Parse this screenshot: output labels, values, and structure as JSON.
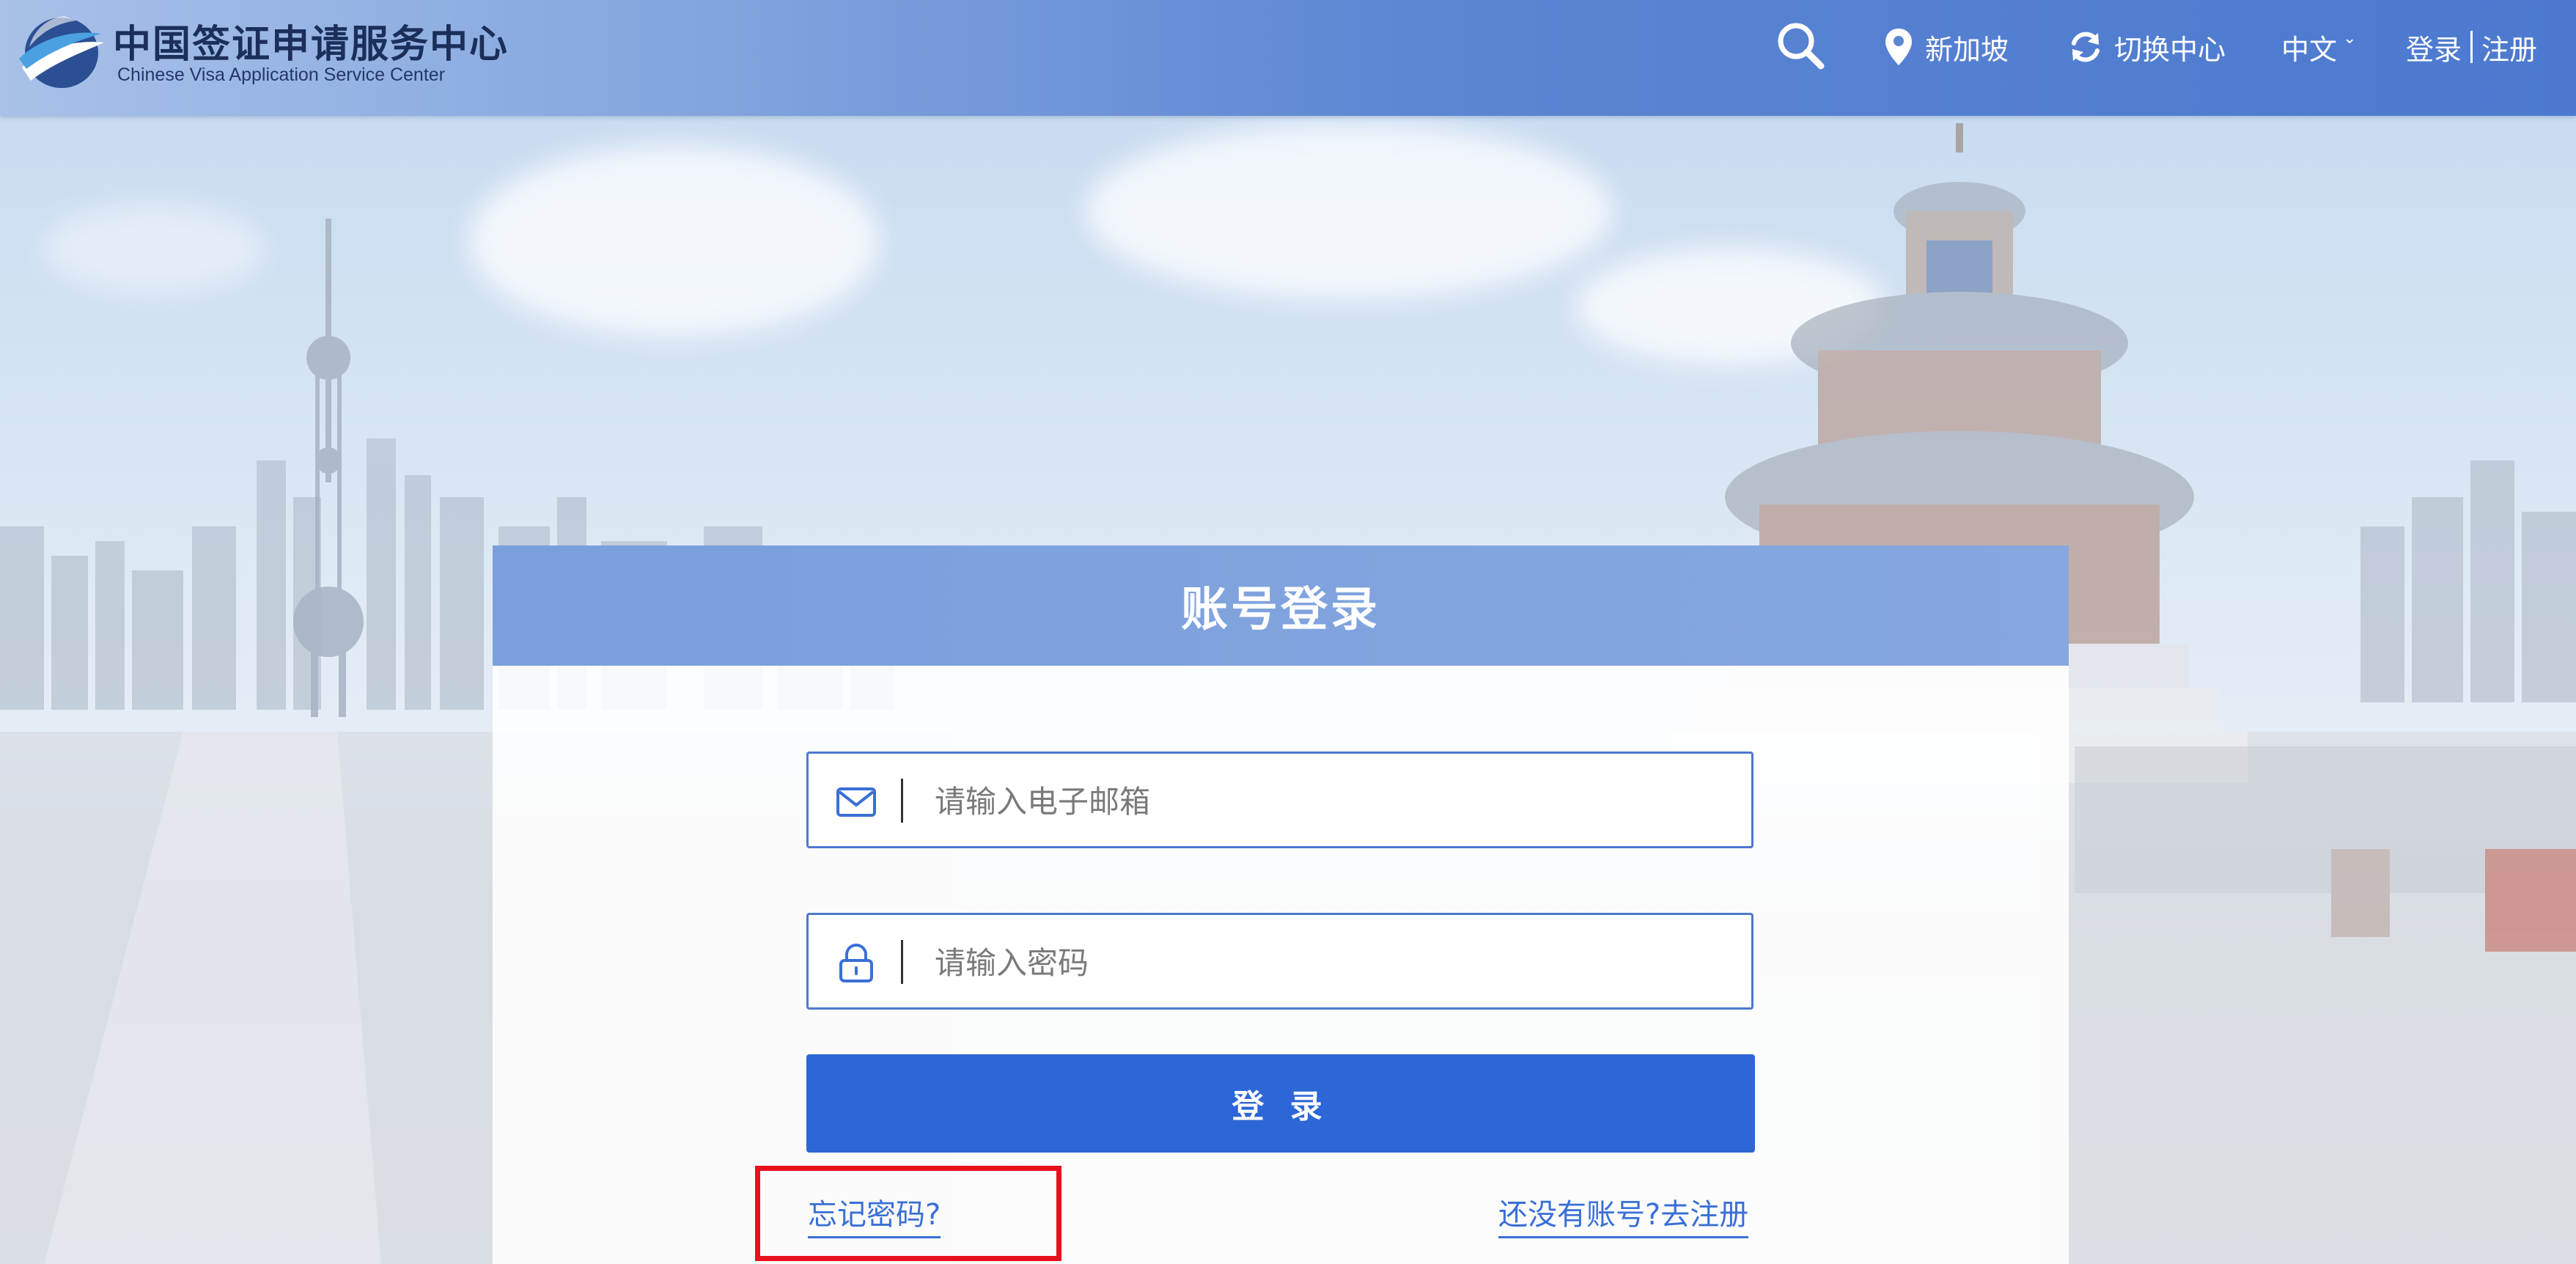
{
  "header": {
    "logo_cn": "中国签证申请服务中心",
    "logo_en": "Chinese Visa Application Service Center",
    "search_icon": "search-icon",
    "location": "新加坡",
    "switch_center": "切换中心",
    "language": "中文",
    "login": "登录",
    "register": "注册"
  },
  "card": {
    "title": "账号登录",
    "email_placeholder": "请输入电子邮箱",
    "password_placeholder": "请输入密码",
    "login_button": "登 录",
    "forgot_password": "忘记密码?",
    "register_link": "还没有账号?去注册"
  },
  "colors": {
    "header_blue": "#4c79cf",
    "primary_button": "#2d66d6",
    "link_blue": "#3a6fd6",
    "highlight_red": "#e8101c"
  }
}
